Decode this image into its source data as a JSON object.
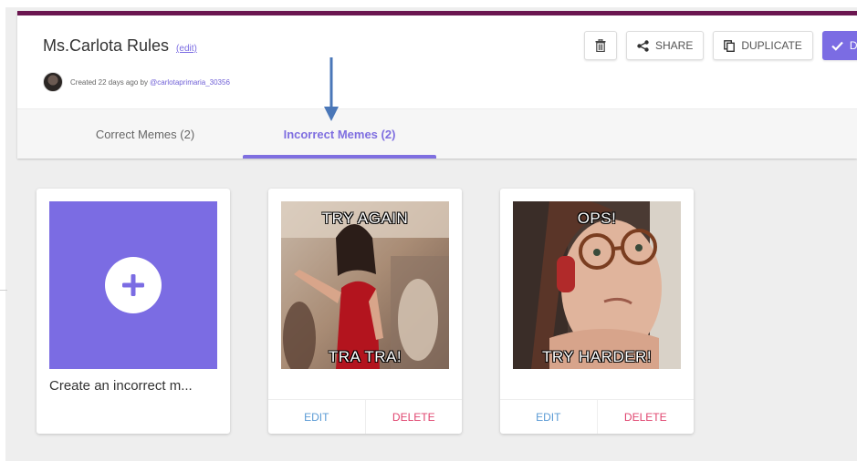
{
  "colors": {
    "accent_bar": "#6b1650",
    "brand_purple": "#7b6ce3",
    "tab_active": "#7f6fe0",
    "edit_blue": "#5b9bd5",
    "delete_pink": "#e0456f",
    "arrow": "#4a77b8"
  },
  "header": {
    "title": "Ms.Carlota Rules",
    "edit_link": "(edit)",
    "created_text": "Created 22 days ago by ",
    "author": "@carlotaprimaria_30356"
  },
  "actions": {
    "delete_icon": "trash-icon",
    "share_label": "SHARE",
    "duplicate_label": "DUPLICATE",
    "done_label": "D"
  },
  "tabs": [
    {
      "label": "Correct Memes (2)",
      "active": false
    },
    {
      "label": "Incorrect Memes (2)",
      "active": true
    }
  ],
  "create_card": {
    "label": "Create an incorrect m..."
  },
  "memes": [
    {
      "top_text": "TRY AGAIN",
      "bottom_text": "TRA TRA!",
      "edit_label": "EDIT",
      "delete_label": "DELETE"
    },
    {
      "top_text": "OPS!",
      "bottom_text": "TRY HARDER!",
      "edit_label": "EDIT",
      "delete_label": "DELETE"
    }
  ]
}
